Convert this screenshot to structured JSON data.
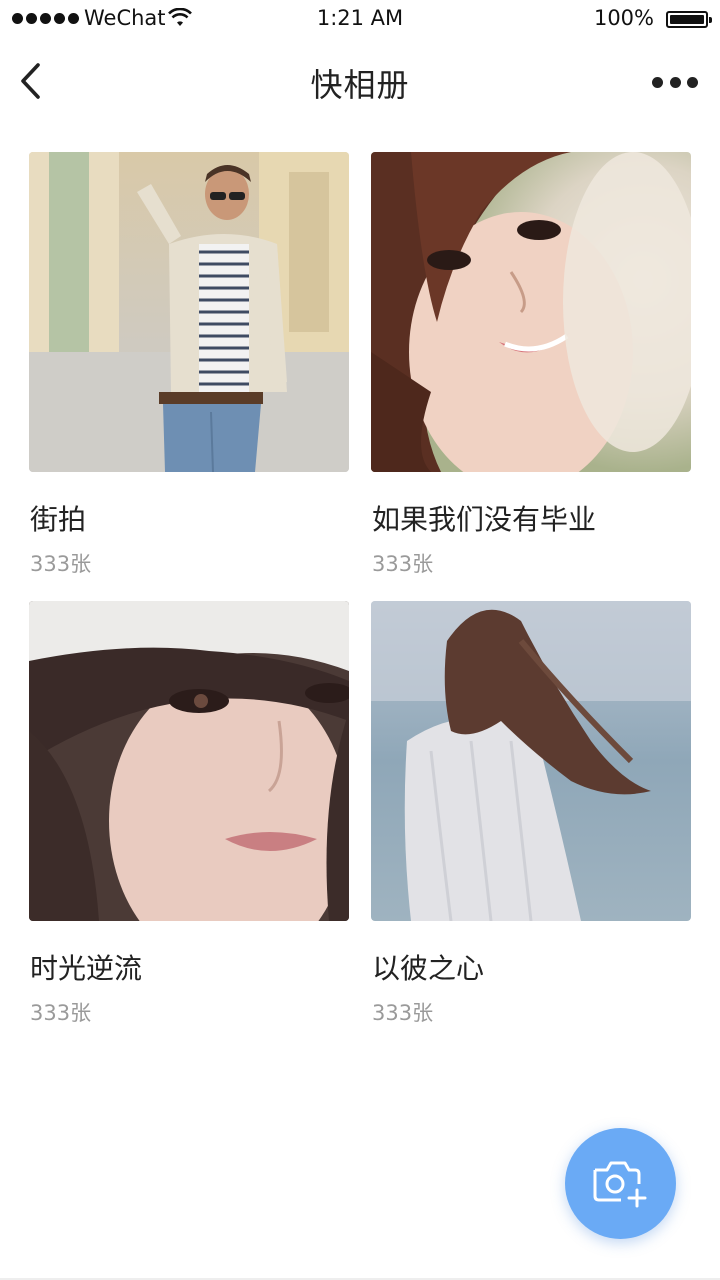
{
  "status_bar": {
    "carrier": "WeChat",
    "time": "1:21 AM",
    "battery": "100%"
  },
  "nav": {
    "title": "快相册",
    "back_icon": "chevron-left-icon",
    "more_icon": "more-dots-icon"
  },
  "albums": [
    {
      "name": "街拍",
      "count": "333张",
      "cover": "man-street-photo"
    },
    {
      "name": "如果我们没有毕业",
      "count": "333张",
      "cover": "woman-smiling-photo"
    },
    {
      "name": "时光逆流",
      "count": "333张",
      "cover": "woman-hat-portrait-photo"
    },
    {
      "name": "以彼之心",
      "count": "333张",
      "cover": "woman-windblown-hair-photo"
    }
  ],
  "fab": {
    "icon": "camera-plus-icon"
  },
  "colors": {
    "accent": "#6aaaf5",
    "count_text": "#9a9a9a"
  }
}
